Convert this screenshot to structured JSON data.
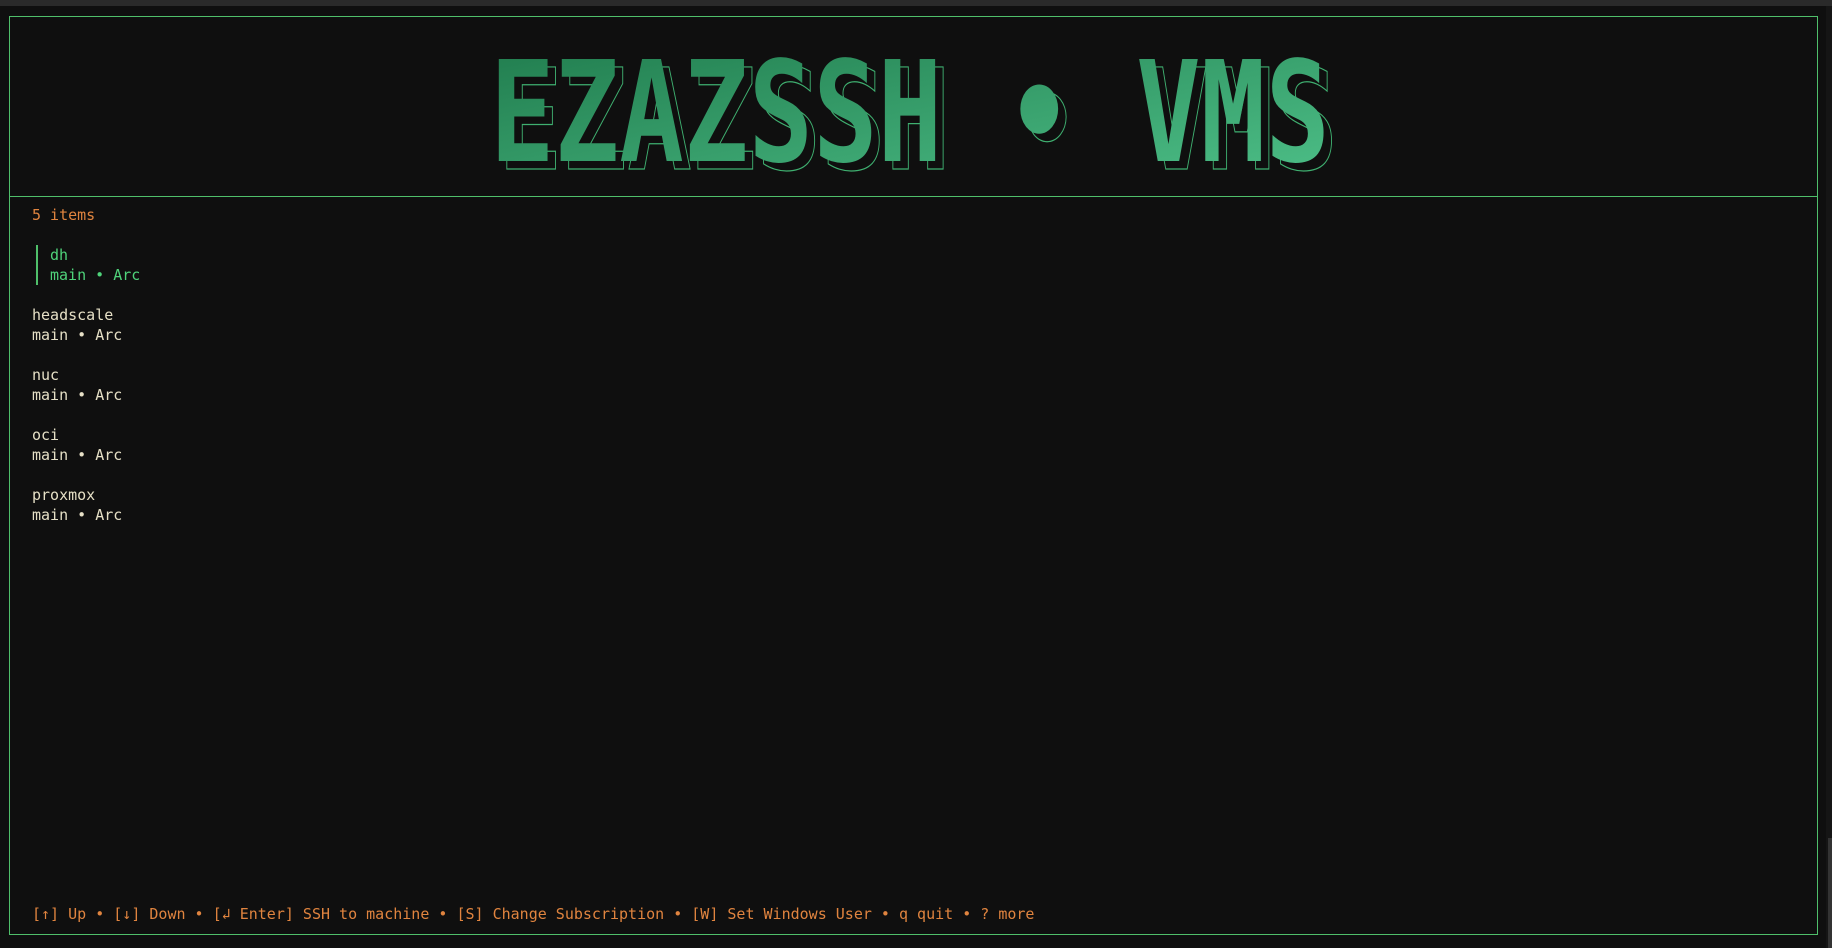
{
  "header": {
    "logo_text": "EZAZSSH • VMS",
    "logo_gradient": [
      "#1f7a4c",
      "#4fc28a"
    ]
  },
  "list": {
    "count_label": "5 items",
    "items": [
      {
        "name": "dh",
        "detail": "main • Arc",
        "selected": true
      },
      {
        "name": "headscale",
        "detail": "main • Arc",
        "selected": false
      },
      {
        "name": "nuc",
        "detail": "main • Arc",
        "selected": false
      },
      {
        "name": "oci",
        "detail": "main • Arc",
        "selected": false
      },
      {
        "name": "proxmox",
        "detail": "main • Arc",
        "selected": false
      }
    ]
  },
  "footer": {
    "up": "[↑] Up",
    "down": "[↓] Down",
    "enter": "[↲ Enter] SSH to machine",
    "subscription": "[S] Change Subscription",
    "windows_user": "[W] Set Windows User",
    "quit": "q quit",
    "more": "? more",
    "separator": " • "
  },
  "colors": {
    "accent_green": "#4fbf6a",
    "orange": "#e0843f",
    "text": "#e6e0c6",
    "background": "#0f0f0f"
  }
}
